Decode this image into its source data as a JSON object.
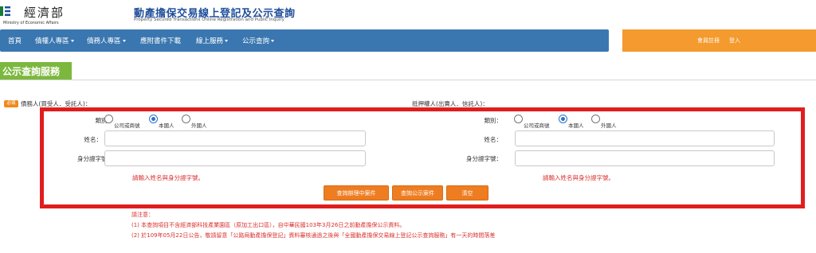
{
  "header": {
    "org_name": "經濟部",
    "org_english": "Ministry of Economic Affairs",
    "site_title": "動產擔保交易線上登記及公示查詢",
    "site_subtitle": "Property Secured Transactions Online Registration and Public Inquiry"
  },
  "nav": {
    "items": [
      {
        "label": "首頁",
        "dropdown": false
      },
      {
        "label": "債權人專區",
        "dropdown": true
      },
      {
        "label": "債務人專區",
        "dropdown": true
      },
      {
        "label": "應附書件下載",
        "dropdown": false
      },
      {
        "label": "線上服務",
        "dropdown": true
      },
      {
        "label": "公示查詢",
        "dropdown": true
      }
    ],
    "register_label": "會員註冊",
    "login_label": "登入"
  },
  "section": {
    "title": "公示查詢服務"
  },
  "form": {
    "required_badge": "必填",
    "debtor": {
      "heading": "債務人(買受人．受託人)：",
      "type_label": "類別：",
      "type_options": [
        "公司或商號",
        "本國人",
        "外國人"
      ],
      "type_selected": "本國人",
      "name_label": "姓名：",
      "id_label": "身分證字號：",
      "hint": "請輸入姓名與身分證字號。"
    },
    "mortgagor": {
      "heading": "抵押權人(出賣人．信託人)：",
      "type_label": "類別：",
      "type_options": [
        "公司或商號",
        "本國人",
        "外國人"
      ],
      "type_selected": "本國人",
      "name_label": "姓名：",
      "id_label": "身分證字號：",
      "hint": "請輸入姓名與身分證字號。"
    },
    "buttons": {
      "query_pending": "查詢辦理中案件",
      "query_public": "查詢公示案件",
      "clear": "清空"
    }
  },
  "notes": {
    "title": "請注意：",
    "lines": [
      "(1) 本查詢項目不含經濟部科技產業園區（原加工出口區），自中華民國103年3月26日之前動產擔保公示資料。",
      "(2) 於109年05月22日公告，敬請留意「公路局動產擔保登記」資料審核通過之後與「全國動產擔保交易線上登記公示查詢服務」有一天的時間落差"
    ]
  },
  "colors": {
    "nav_bg": "#3a77b0",
    "login_bg": "#f49a2e",
    "section_tab": "#7cb83e",
    "button": "#ee7d22",
    "warning_text": "#d9302b",
    "highlight_frame": "#e01e1e"
  }
}
